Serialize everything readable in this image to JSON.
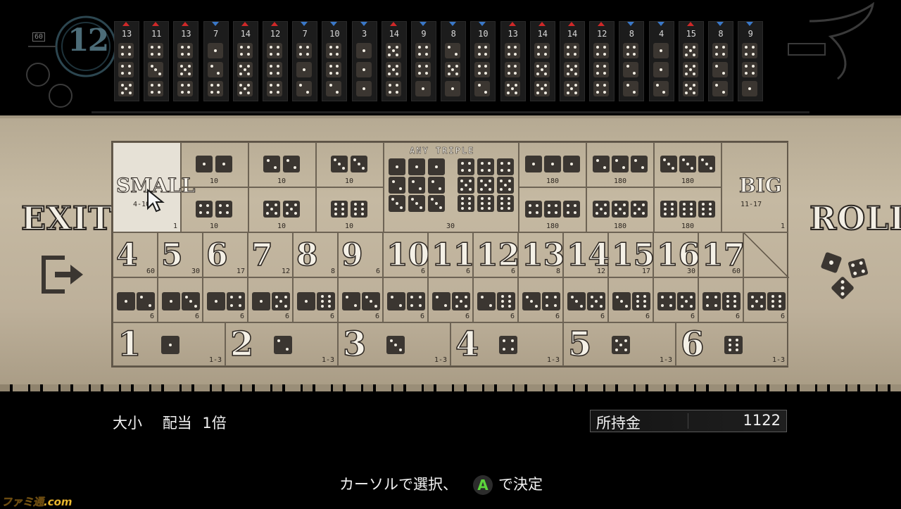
{
  "history": {
    "round": "12",
    "badge": "60",
    "rolls": [
      {
        "sum": "13",
        "dir": "up",
        "dice": [
          4,
          4,
          5
        ]
      },
      {
        "sum": "11",
        "dir": "up",
        "dice": [
          4,
          3,
          4
        ]
      },
      {
        "sum": "13",
        "dir": "up",
        "dice": [
          4,
          5,
          4
        ]
      },
      {
        "sum": "7",
        "dir": "down",
        "dice": [
          1,
          2,
          4
        ]
      },
      {
        "sum": "14",
        "dir": "up",
        "dice": [
          4,
          5,
          5
        ]
      },
      {
        "sum": "12",
        "dir": "up",
        "dice": [
          4,
          4,
          4
        ]
      },
      {
        "sum": "7",
        "dir": "down",
        "dice": [
          4,
          1,
          2
        ]
      },
      {
        "sum": "10",
        "dir": "down",
        "dice": [
          4,
          4,
          2
        ]
      },
      {
        "sum": "3",
        "dir": "down",
        "dice": [
          1,
          1,
          1
        ]
      },
      {
        "sum": "14",
        "dir": "up",
        "dice": [
          5,
          5,
          4
        ]
      },
      {
        "sum": "9",
        "dir": "down",
        "dice": [
          4,
          4,
          1
        ]
      },
      {
        "sum": "8",
        "dir": "down",
        "dice": [
          2,
          5,
          1
        ]
      },
      {
        "sum": "10",
        "dir": "down",
        "dice": [
          4,
          4,
          2
        ]
      },
      {
        "sum": "13",
        "dir": "up",
        "dice": [
          4,
          4,
          5
        ]
      },
      {
        "sum": "14",
        "dir": "up",
        "dice": [
          4,
          5,
          5
        ]
      },
      {
        "sum": "14",
        "dir": "up",
        "dice": [
          4,
          5,
          5
        ]
      },
      {
        "sum": "12",
        "dir": "up",
        "dice": [
          4,
          4,
          4
        ]
      },
      {
        "sum": "8",
        "dir": "down",
        "dice": [
          4,
          2,
          2
        ]
      },
      {
        "sum": "4",
        "dir": "down",
        "dice": [
          1,
          1,
          2
        ]
      },
      {
        "sum": "15",
        "dir": "up",
        "dice": [
          5,
          5,
          5
        ]
      },
      {
        "sum": "8",
        "dir": "down",
        "dice": [
          4,
          2,
          2
        ]
      },
      {
        "sum": "9",
        "dir": "down",
        "dice": [
          4,
          4,
          1
        ]
      }
    ]
  },
  "side": {
    "exit": "EXIT",
    "roll": "ROLL"
  },
  "small": {
    "label": "SMALL",
    "range": "4-10",
    "odds": "1"
  },
  "big": {
    "label": "BIG",
    "range": "11-17",
    "odds": "1"
  },
  "doubles": [
    {
      "face": 1,
      "odds": "10"
    },
    {
      "face": 2,
      "odds": "10"
    },
    {
      "face": 3,
      "odds": "10"
    },
    {
      "face": 4,
      "odds": "10"
    },
    {
      "face": 5,
      "odds": "10"
    },
    {
      "face": 6,
      "odds": "10"
    }
  ],
  "any_triple": {
    "title": "ANY TRIPLE",
    "odds": "30"
  },
  "triples": [
    {
      "face": 1,
      "odds": "180"
    },
    {
      "face": 2,
      "odds": "180"
    },
    {
      "face": 3,
      "odds": "180"
    },
    {
      "face": 4,
      "odds": "180"
    },
    {
      "face": 5,
      "odds": "180"
    },
    {
      "face": 6,
      "odds": "180"
    }
  ],
  "totals": [
    {
      "num": "4",
      "odds": "60"
    },
    {
      "num": "5",
      "odds": "30"
    },
    {
      "num": "6",
      "odds": "17"
    },
    {
      "num": "7",
      "odds": "12"
    },
    {
      "num": "8",
      "odds": "8"
    },
    {
      "num": "9",
      "odds": "6"
    },
    {
      "num": "10",
      "odds": "6"
    },
    {
      "num": "11",
      "odds": "6"
    },
    {
      "num": "12",
      "odds": "6"
    },
    {
      "num": "13",
      "odds": "8"
    },
    {
      "num": "14",
      "odds": "12"
    },
    {
      "num": "15",
      "odds": "17"
    },
    {
      "num": "16",
      "odds": "30"
    },
    {
      "num": "17",
      "odds": "60"
    }
  ],
  "combos": [
    {
      "a": 1,
      "b": 2,
      "odds": "6"
    },
    {
      "a": 1,
      "b": 3,
      "odds": "6"
    },
    {
      "a": 1,
      "b": 4,
      "odds": "6"
    },
    {
      "a": 1,
      "b": 5,
      "odds": "6"
    },
    {
      "a": 1,
      "b": 6,
      "odds": "6"
    },
    {
      "a": 2,
      "b": 3,
      "odds": "6"
    },
    {
      "a": 2,
      "b": 4,
      "odds": "6"
    },
    {
      "a": 2,
      "b": 5,
      "odds": "6"
    },
    {
      "a": 2,
      "b": 6,
      "odds": "6"
    },
    {
      "a": 3,
      "b": 4,
      "odds": "6"
    },
    {
      "a": 3,
      "b": 5,
      "odds": "6"
    },
    {
      "a": 3,
      "b": 6,
      "odds": "6"
    },
    {
      "a": 4,
      "b": 5,
      "odds": "6"
    },
    {
      "a": 4,
      "b": 6,
      "odds": "6"
    },
    {
      "a": 5,
      "b": 6,
      "odds": "6"
    }
  ],
  "singles": [
    {
      "num": "1",
      "face": 1,
      "odds": "1-3"
    },
    {
      "num": "2",
      "face": 2,
      "odds": "1-3"
    },
    {
      "num": "3",
      "face": 3,
      "odds": "1-3"
    },
    {
      "num": "4",
      "face": 4,
      "odds": "1-3"
    },
    {
      "num": "5",
      "face": 5,
      "odds": "1-3"
    },
    {
      "num": "6",
      "face": 6,
      "odds": "1-3"
    }
  ],
  "footer": {
    "bet_name": "大小",
    "payout_label": "配当",
    "payout_value": "1倍",
    "money_label": "所持金",
    "money_value": "1122",
    "hint_left": "カーソルで選択、",
    "button": "A",
    "hint_right": "で決定"
  },
  "watermark": "ファミ通.com",
  "colors": {
    "up": "#d02828",
    "down": "#3a78c8",
    "board": "#bdb09a",
    "die": "#3b3631",
    "accent": "#5cd43c"
  }
}
